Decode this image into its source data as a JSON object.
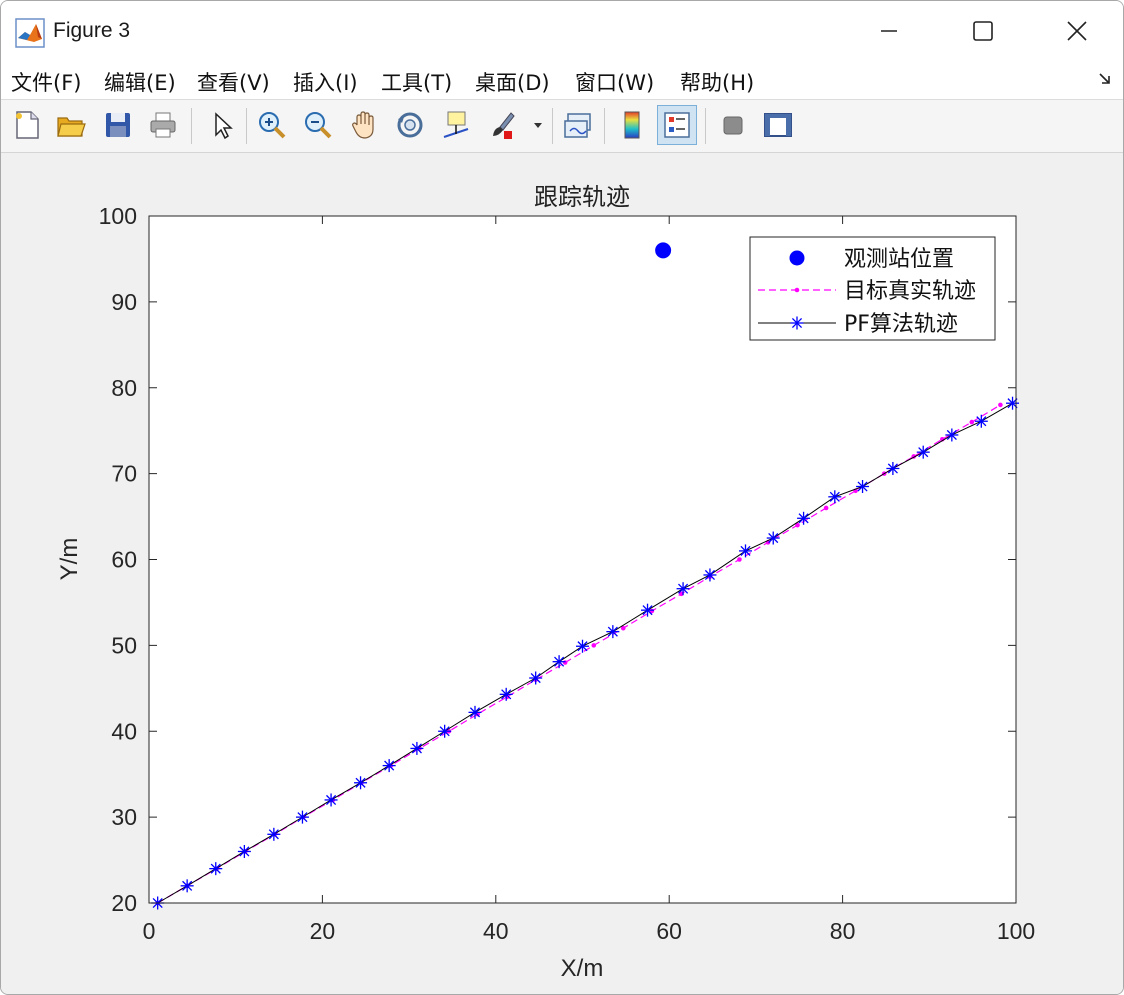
{
  "window": {
    "title": "Figure 3"
  },
  "menu": [
    {
      "label": "文件(F)",
      "name": "menu-file"
    },
    {
      "label": "编辑(E)",
      "name": "menu-edit"
    },
    {
      "label": "查看(V)",
      "name": "menu-view"
    },
    {
      "label": "插入(I)",
      "name": "menu-insert"
    },
    {
      "label": "工具(T)",
      "name": "menu-tools"
    },
    {
      "label": "桌面(D)",
      "name": "menu-desktop"
    },
    {
      "label": "窗口(W)",
      "name": "menu-window"
    },
    {
      "label": "帮助(H)",
      "name": "menu-help"
    }
  ],
  "toolbar": {
    "icons": [
      "new-figure-icon",
      "open-file-icon",
      "save-icon",
      "print-icon",
      "pointer-icon",
      "zoom-in-icon",
      "zoom-out-icon",
      "pan-hand-icon",
      "rotate-3d-icon",
      "data-cursor-icon",
      "brush-icon",
      "link-plot-icon",
      "colorbar-icon",
      "legend-icon",
      "hide-plot-tools-icon",
      "show-plot-tools-icon"
    ],
    "active": "legend-icon"
  },
  "colors": {
    "station": "#0000ff",
    "true_track": "#ff00ff",
    "pf_line": "#000000",
    "pf_marker": "#0000ff"
  },
  "chart_data": {
    "type": "line",
    "title": "跟踪轨迹",
    "xlabel": "X/m",
    "ylabel": "Y/m",
    "xlim": [
      0,
      100
    ],
    "ylim": [
      20,
      100
    ],
    "xticks": [
      0,
      20,
      40,
      60,
      80,
      100
    ],
    "yticks": [
      20,
      30,
      40,
      50,
      60,
      70,
      80,
      90,
      100
    ],
    "grid": false,
    "legend_position": "top-right",
    "series": [
      {
        "name": "观测站位置",
        "style": "marker-dot",
        "x": [
          59.3
        ],
        "y": [
          96
        ]
      },
      {
        "name": "目标真实轨迹",
        "style": "dashed-dot",
        "x": [
          1.0,
          4.4,
          7.8,
          11.1,
          14.5,
          17.8,
          21.2,
          24.5,
          27.9,
          31.2,
          34.6,
          37.9,
          41.3,
          44.6,
          48.0,
          51.3,
          54.7,
          58.0,
          61.4,
          64.7,
          68.1,
          71.4,
          74.8,
          78.1,
          81.5,
          84.8,
          88.2,
          91.5,
          94.9,
          98.2
        ],
        "y": [
          20.0,
          22.0,
          24.0,
          26.0,
          28.0,
          30.0,
          32.0,
          34.0,
          36.0,
          38.0,
          40.0,
          42.0,
          44.0,
          46.0,
          48.0,
          50.0,
          52.0,
          54.0,
          56.0,
          58.0,
          60.0,
          62.0,
          64.0,
          66.0,
          68.0,
          70.0,
          72.0,
          74.0,
          76.0,
          78.0
        ]
      },
      {
        "name": "PF算法轨迹",
        "style": "solid-star",
        "x": [
          1.0,
          4.4,
          7.7,
          11.0,
          14.4,
          17.7,
          21.0,
          24.4,
          27.7,
          30.9,
          34.1,
          37.6,
          41.2,
          44.6,
          47.3,
          50.0,
          53.5,
          57.5,
          61.6,
          64.7,
          68.8,
          72.0,
          75.5,
          79.1,
          82.3,
          85.8,
          89.3,
          92.6,
          96.0,
          99.6
        ],
        "y": [
          20.0,
          22.0,
          24.0,
          26.0,
          28.0,
          30.0,
          32.0,
          34.0,
          36.0,
          38.0,
          40.0,
          42.2,
          44.3,
          46.2,
          48.1,
          49.9,
          51.6,
          54.1,
          56.6,
          58.2,
          61.0,
          62.5,
          64.8,
          67.3,
          68.5,
          70.6,
          72.5,
          74.5,
          76.1,
          78.2
        ]
      }
    ]
  }
}
